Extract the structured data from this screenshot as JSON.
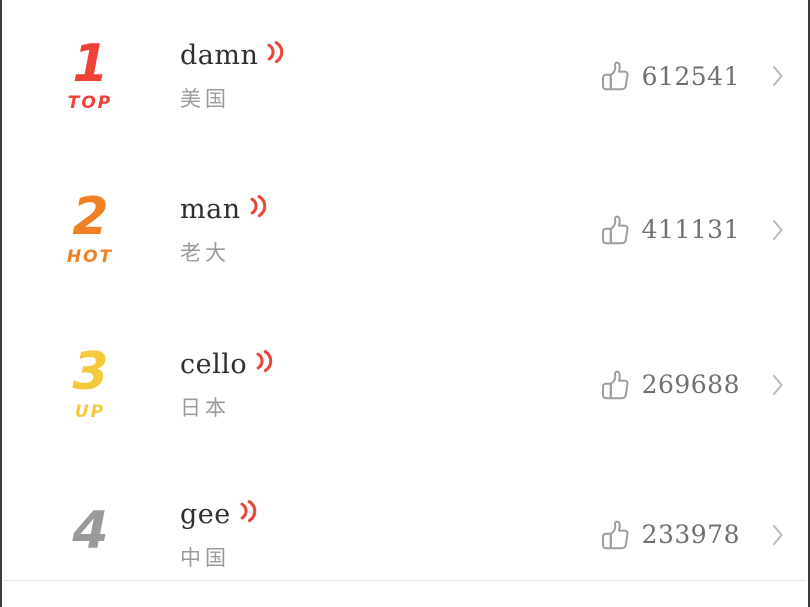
{
  "theme": {
    "background": "#ffffff",
    "frame_border": "#3a3a3c",
    "word_color": "#2f2f2f",
    "translation_color": "#9b9b9b",
    "count_color": "#6f7072",
    "divider_color": "#e3e3e5",
    "sound_icon_color": "#e8483c",
    "thumb_icon_color": "#9b9ea1",
    "chevron_color": "#8f9194"
  },
  "list": {
    "rows": [
      {
        "rank": "1",
        "tag": "TOP",
        "rank_color": "#ef4136",
        "word": "damn",
        "translation": "美国",
        "likes": "612541",
        "sound_icon": "sound-wave-icon",
        "thumb_icon": "thumbs-up-icon",
        "chevron_icon": "chevron-right-icon"
      },
      {
        "rank": "2",
        "tag": "HOT",
        "rank_color": "#f08024",
        "word": "man",
        "translation": "老大",
        "likes": "411131",
        "sound_icon": "sound-wave-icon",
        "thumb_icon": "thumbs-up-icon",
        "chevron_icon": "chevron-right-icon"
      },
      {
        "rank": "3",
        "tag": "UP",
        "rank_color": "#f5c93c",
        "word": "cello",
        "translation": "日本",
        "likes": "269688",
        "sound_icon": "sound-wave-icon",
        "thumb_icon": "thumbs-up-icon",
        "chevron_icon": "chevron-right-icon"
      },
      {
        "rank": "4",
        "tag": "",
        "rank_color": "#9a9a9a",
        "word": "gee",
        "translation": "中国",
        "likes": "233978",
        "sound_icon": "sound-wave-icon",
        "thumb_icon": "thumbs-up-icon",
        "chevron_icon": "chevron-right-icon"
      }
    ]
  }
}
